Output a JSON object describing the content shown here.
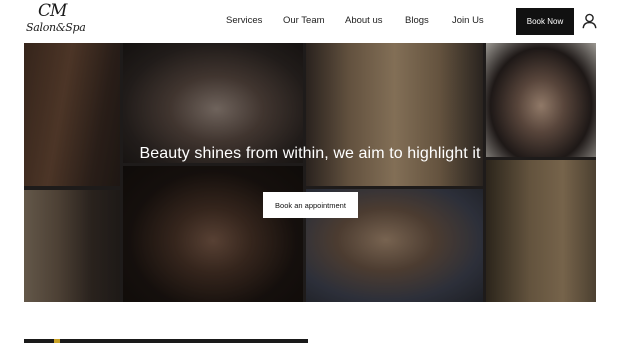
{
  "header": {
    "logo_line1": "CM",
    "logo_line2": "Salon&Spa",
    "nav": {
      "services": "Services",
      "our_team": "Our Team",
      "about_us": "About us",
      "blogs": "Blogs",
      "join_us": "Join Us"
    },
    "book_now": "Book Now"
  },
  "hero": {
    "title": "Beauty shines from within, we aim to highlight it",
    "cta": "Book an appointment"
  }
}
